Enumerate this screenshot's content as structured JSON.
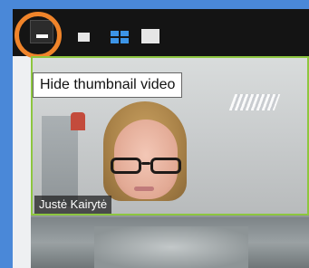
{
  "toolbar": {
    "buttons": [
      {
        "name": "hide-thumbnail-video-button",
        "icon": "minimize-bar-icon",
        "highlighted": true
      },
      {
        "name": "single-speaker-button",
        "icon": "single-view-icon"
      },
      {
        "name": "gallery-view-button",
        "icon": "grid-view-icon"
      },
      {
        "name": "full-screen-button",
        "icon": "full-view-icon"
      }
    ],
    "highlight_color": "#f0842a",
    "grid_icon_color": "#3c94e6"
  },
  "tooltip": {
    "text": "Hide thumbnail video"
  },
  "video": {
    "participant_name": "Justė Kairytė",
    "active_border_color": "#8dc63f"
  },
  "colors": {
    "window_frame": "#4a88d8",
    "toolbar_bg": "#141414"
  }
}
